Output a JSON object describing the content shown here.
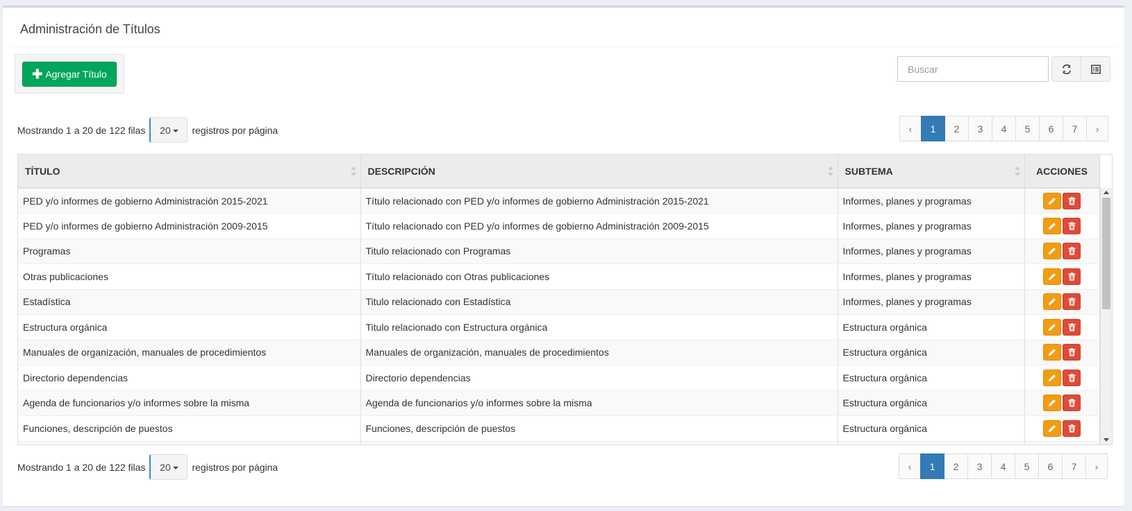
{
  "header": {
    "title": "Administración de Títulos"
  },
  "toolbar": {
    "add_label": "Agregar Título",
    "search_placeholder": "Buscar",
    "refresh_icon": "refresh-icon",
    "columns_icon": "columns-list-icon"
  },
  "pagination_top": {
    "info": "Mostrando 1 a 20 de 122 filas",
    "page_size": "20",
    "per_page_label": "registros por página",
    "prev": "‹",
    "next": "›",
    "pages": [
      "1",
      "2",
      "3",
      "4",
      "5",
      "6",
      "7"
    ],
    "active_page": "1"
  },
  "pagination_bottom": {
    "info": "Mostrando 1 a 20 de 122 filas",
    "page_size": "20",
    "per_page_label": "registros por página",
    "prev": "‹",
    "next": "›",
    "pages": [
      "1",
      "2",
      "3",
      "4",
      "5",
      "6",
      "7"
    ],
    "active_page": "1"
  },
  "table": {
    "columns": [
      "TÍTULO",
      "DESCRIPCIÓN",
      "SUBTEMA",
      "ACCIONES"
    ],
    "rows": [
      [
        "PED y/o informes de gobierno Administración 2015-2021",
        "Título relacionado con PED y/o informes de gobierno Administración 2015-2021",
        "Informes, planes y programas"
      ],
      [
        "PED y/o informes de gobierno Administración 2009-2015",
        "Título relacionado con PED y/o informes de gobierno Administración 2009-2015",
        "Informes, planes y programas"
      ],
      [
        "Programas",
        "Titulo relacionado con Programas",
        "Informes, planes y programas"
      ],
      [
        "Otras publicaciones",
        "Título relacionado con Otras publicaciones",
        "Informes, planes y programas"
      ],
      [
        "Estadística",
        "Titulo relacionado con Estadística",
        "Informes, planes y programas"
      ],
      [
        "Estructura orgánica",
        "Titulo relacionado con Estructura orgánica",
        "Estructura orgánica"
      ],
      [
        "Manuales de organización, manuales de procedimientos",
        "Manuales de organización, manuales de procedimientos",
        "Estructura orgánica"
      ],
      [
        "Directorio dependencias",
        "Directorio dependencias",
        "Estructura orgánica"
      ],
      [
        "Agenda de funcionarios y/o informes sobre la misma",
        "Agenda de funcionarios y/o informes sobre la misma",
        "Estructura orgánica"
      ],
      [
        "Funciones, descripción de puestos",
        "Funciones, descripción de puestos",
        "Estructura orgánica"
      ],
      [
        "",
        "",
        ""
      ]
    ]
  },
  "colors": {
    "add_button": "#00a65a",
    "active_page": "#337ab7",
    "edit_button": "#f39c12",
    "delete_button": "#dd4b39"
  }
}
